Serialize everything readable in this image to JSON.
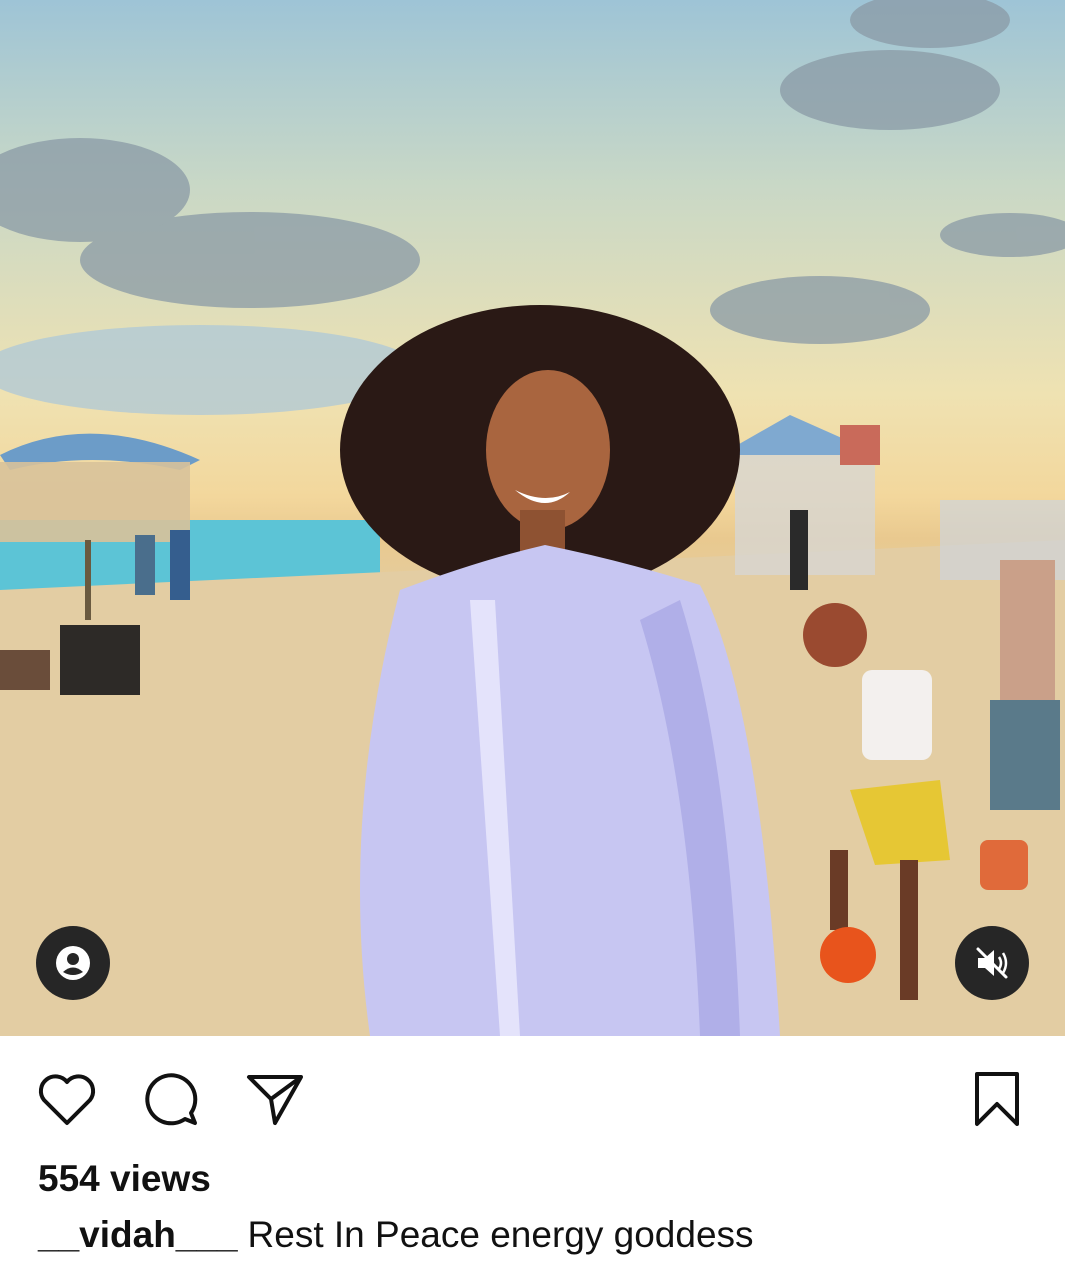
{
  "post": {
    "views": "554 views",
    "username": "__vidah___",
    "caption": "Rest In Peace energy goddess"
  },
  "icons": {
    "tag": "person-tag-icon",
    "mute": "muted-speaker-icon",
    "like": "heart-icon",
    "comment": "comment-bubble-icon",
    "share": "paper-plane-icon",
    "save": "bookmark-icon"
  }
}
